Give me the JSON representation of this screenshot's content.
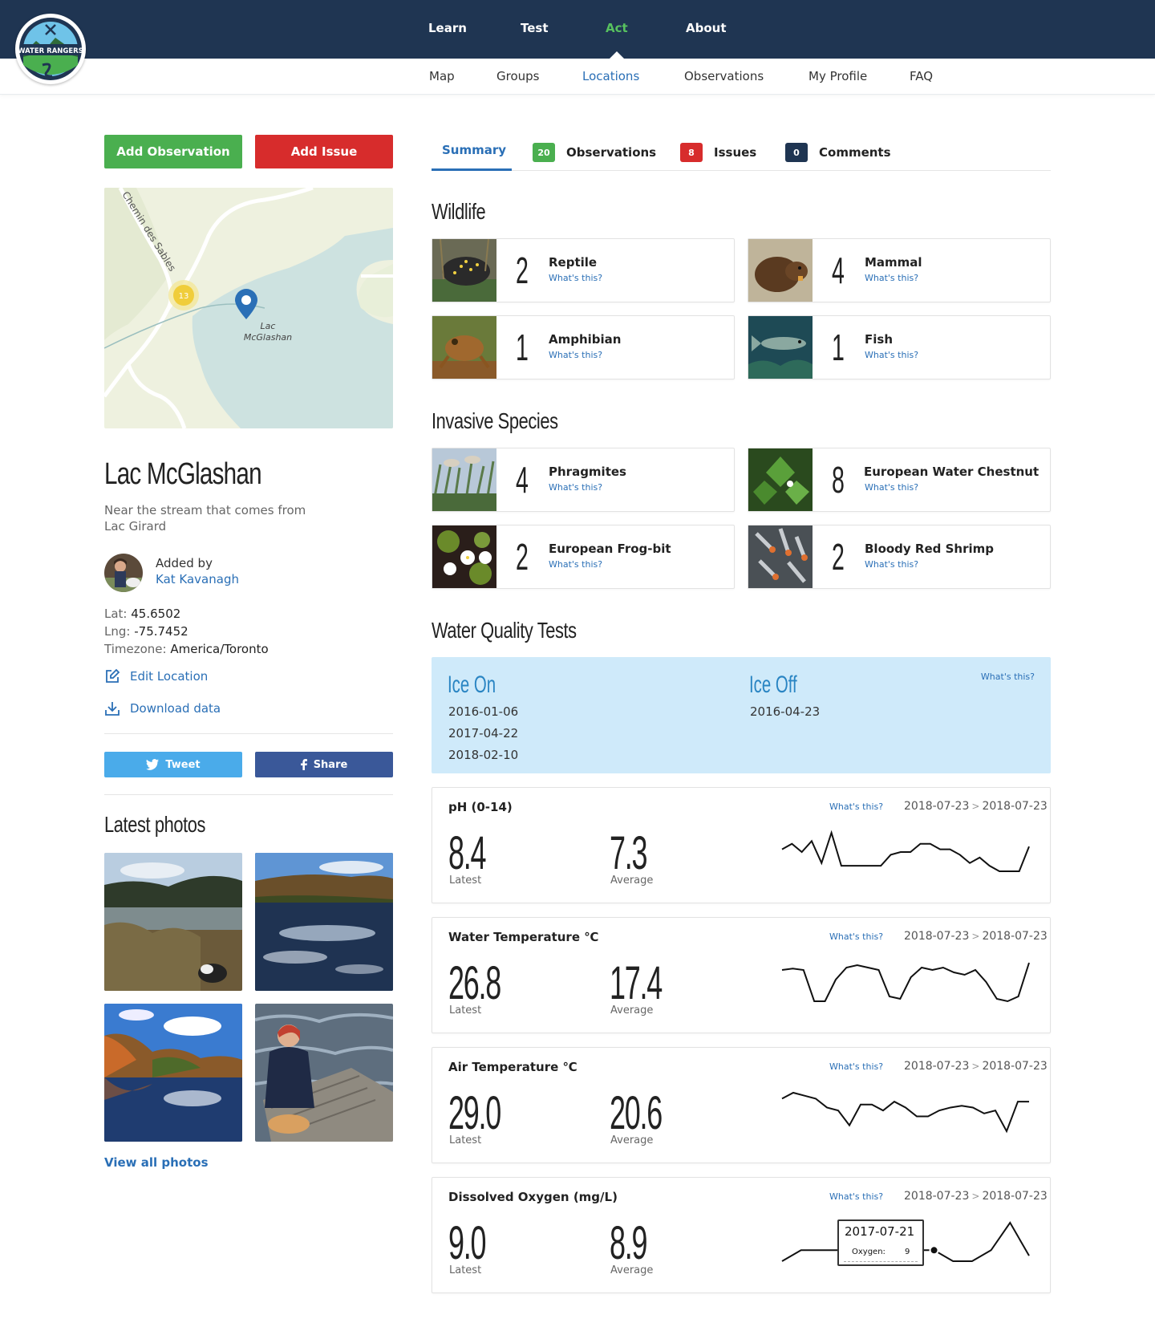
{
  "logo": {
    "text": "WATER RANGERS"
  },
  "main_nav": [
    {
      "label": "Learn",
      "active": false
    },
    {
      "label": "Test",
      "active": false
    },
    {
      "label": "Act",
      "active": true
    },
    {
      "label": "About",
      "active": false
    }
  ],
  "sub_nav": [
    {
      "label": "Map",
      "active": false
    },
    {
      "label": "Groups",
      "active": false
    },
    {
      "label": "Locations",
      "active": true
    },
    {
      "label": "Observations",
      "active": false
    },
    {
      "label": "My Profile",
      "active": false
    },
    {
      "label": "FAQ",
      "active": false
    }
  ],
  "sidebar": {
    "add_observation": "Add Observation",
    "add_issue": "Add Issue",
    "map": {
      "road_label": "Chemin des Sables",
      "cluster_count": "13",
      "lake_label_1": "Lac",
      "lake_label_2": "McGlashan"
    },
    "location_name": "Lac McGlashan",
    "description": "Near the stream that comes from Lac Girard",
    "added_by_label": "Added by",
    "added_by_name": "Kat Kavanagh",
    "lat_label": "Lat:",
    "lat": "45.6502",
    "lng_label": "Lng:",
    "lng": "-75.7452",
    "tz_label": "Timezone:",
    "tz": "America/Toronto",
    "edit_location": "Edit Location",
    "download_data": "Download data",
    "tweet": "Tweet",
    "share": "Share",
    "latest_photos": "Latest photos",
    "view_all_photos": "View all photos"
  },
  "tabs": {
    "summary": "Summary",
    "observations_count": "20",
    "observations": "Observations",
    "issues_count": "8",
    "issues": "Issues",
    "comments_count": "0",
    "comments": "Comments"
  },
  "wildlife": {
    "title": "Wildlife",
    "items": [
      {
        "count": "2",
        "name": "Reptile",
        "what": "What's this?"
      },
      {
        "count": "4",
        "name": "Mammal",
        "what": "What's this?"
      },
      {
        "count": "1",
        "name": "Amphibian",
        "what": "What's this?"
      },
      {
        "count": "1",
        "name": "Fish",
        "what": "What's this?"
      }
    ]
  },
  "invasive": {
    "title": "Invasive Species",
    "items": [
      {
        "count": "4",
        "name": "Phragmites",
        "what": "What's this?"
      },
      {
        "count": "8",
        "name": "European Water Chestnut",
        "what": "What's this?"
      },
      {
        "count": "2",
        "name": "European Frog-bit",
        "what": "What's this?"
      },
      {
        "count": "2",
        "name": "Bloody Red Shrimp",
        "what": "What's this?"
      }
    ]
  },
  "water_quality": {
    "title": "Water Quality Tests",
    "ice": {
      "ice_on_title": "Ice On",
      "ice_on_dates": [
        "2016-01-06",
        "2017-04-22",
        "2018-02-10"
      ],
      "ice_off_title": "Ice Off",
      "ice_off_dates": [
        "2016-04-23"
      ],
      "what": "What's this?"
    },
    "tests": [
      {
        "title": "pH (0-14)",
        "what": "What's this?",
        "from": "2018-07-23",
        "sep": ">",
        "to": "2018-07-23",
        "latest": "8.4",
        "latest_label": "Latest",
        "average": "7.3",
        "average_label": "Average",
        "spark": [
          7.0,
          7.2,
          6.9,
          7.3,
          6.5,
          7.6,
          6.4,
          6.4,
          6.4,
          6.4,
          6.4,
          6.8,
          6.9,
          6.9,
          7.2,
          7.2,
          7.0,
          7.0,
          6.8,
          6.5,
          6.7,
          6.4,
          6.2,
          6.2,
          6.2,
          7.1
        ]
      },
      {
        "title": "Water Temperature ℃",
        "what": "What's this?",
        "from": "2018-07-23",
        "sep": ">",
        "to": "2018-07-23",
        "latest": "26.8",
        "latest_label": "Latest",
        "average": "17.4",
        "average_label": "Average",
        "spark": [
          18.5,
          18.8,
          18.5,
          12.0,
          12.0,
          16.5,
          19.0,
          19.5,
          19.0,
          18.5,
          13.0,
          12.5,
          17.0,
          19.0,
          18.5,
          19.0,
          18.0,
          17.5,
          18.5,
          16.0,
          12.5,
          12.0,
          13.0,
          20.0
        ]
      },
      {
        "title": "Air Temperature ℃",
        "what": "What's this?",
        "from": "2018-07-23",
        "sep": ">",
        "to": "2018-07-23",
        "latest": "29.0",
        "latest_label": "Latest",
        "average": "20.6",
        "average_label": "Average",
        "spark": [
          23.0,
          24.0,
          23.5,
          23.0,
          21.5,
          21.0,
          18.5,
          22.0,
          22.0,
          21.0,
          22.5,
          21.5,
          20.0,
          20.0,
          21.0,
          21.5,
          21.8,
          21.5,
          20.5,
          21.0,
          17.5,
          22.5,
          22.5
        ]
      },
      {
        "title": "Dissolved Oxygen (mg/L)",
        "what": "What's this?",
        "from": "2018-07-23",
        "sep": ">",
        "to": "2018-07-23",
        "latest": "9.0",
        "latest_label": "Latest",
        "average": "8.9",
        "average_label": "Average",
        "spark": [
          8.8,
          9.0,
          9.0,
          9.0,
          9.0,
          9.0,
          9.0,
          9.0,
          9.0,
          8.8,
          8.8,
          9.0,
          9.5,
          8.9
        ],
        "tooltip": {
          "date": "2017-07-21",
          "label": "Oxygen:",
          "value": "9"
        }
      }
    ]
  }
}
